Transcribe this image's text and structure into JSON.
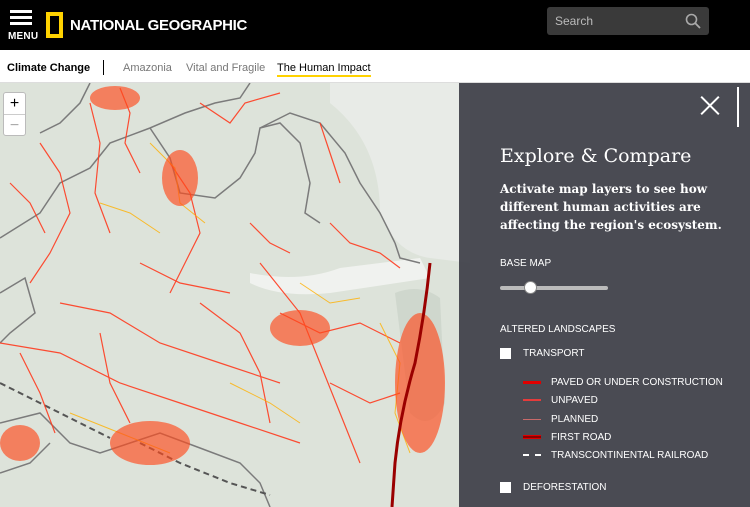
{
  "header": {
    "menu_label": "MENU",
    "logo_text": "NATIONAL GEOGRAPHIC",
    "brand_color": "#ffd200",
    "search_placeholder": "Search"
  },
  "subnav": {
    "section": "Climate Change",
    "tabs": [
      {
        "label": "Amazonia",
        "active": false
      },
      {
        "label": "Vital and Fragile",
        "active": false
      },
      {
        "label": "The Human Impact",
        "active": true
      }
    ]
  },
  "map": {
    "zoom_in": "+",
    "zoom_out": "−"
  },
  "panel": {
    "title": "Explore & Compare",
    "description": "Activate map layers to see how different human activities are affecting the region's ecosystem.",
    "base_map_label": "BASE MAP",
    "base_map_opacity": 0.25,
    "altered_label": "ALTERED LANDSCAPES",
    "layers": [
      {
        "label": "TRANSPORT",
        "checked": false
      },
      {
        "label": "DEFORESTATION",
        "checked": false
      }
    ],
    "legend": [
      {
        "label": "PAVED OR UNDER CONSTRUCTION",
        "color": "#e00000",
        "style": "solid-thick"
      },
      {
        "label": "UNPAVED",
        "color": "#e53b3b",
        "style": "solid"
      },
      {
        "label": "PLANNED",
        "color": "#c86a6a",
        "style": "thin"
      },
      {
        "label": "FIRST ROAD",
        "color": "#8b0000",
        "style": "solid-thick"
      },
      {
        "label": "TRANSCONTINENTAL RAILROAD",
        "color": "#ffffff",
        "style": "dashed"
      }
    ]
  }
}
